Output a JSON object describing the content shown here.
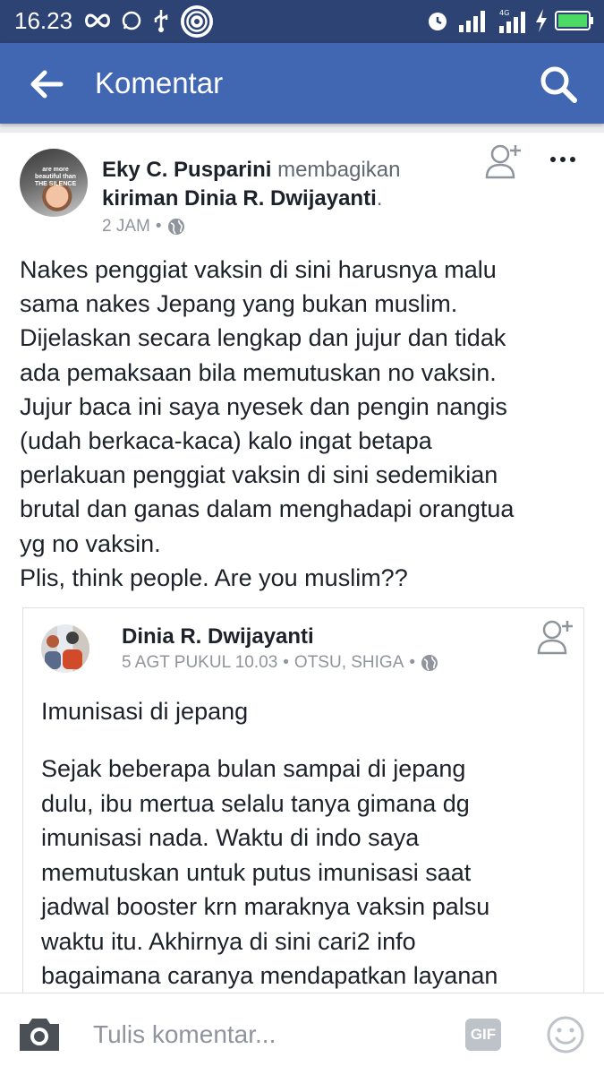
{
  "status_bar": {
    "time": "16.23",
    "icons": [
      "infinity-icon",
      "whatsapp-icon",
      "usb-icon",
      "hotspot-icon",
      "alarm-icon",
      "signal-icon",
      "4g-signal-icon",
      "charging-icon",
      "battery-icon"
    ]
  },
  "app_bar": {
    "title": "Komentar",
    "back_icon": "arrow-left-icon",
    "search_icon": "search-icon"
  },
  "post": {
    "author": "Eky C. Pusparini",
    "action": "membagikan",
    "shared_from": "kiriman Dinia R. Dwijayanti",
    "period": ".",
    "time": "2 JAM",
    "separator": "•",
    "privacy_icon": "globe-icon",
    "avatar_text": "are more beautiful than THE SILENCE",
    "lines": [
      "Nakes penggiat vaksin di sini harusnya malu",
      "sama nakes Jepang yang bukan muslim.",
      "Dijelaskan secara lengkap dan jujur dan tidak",
      "ada pemaksaan bila memutuskan no vaksin.",
      "Jujur baca ini saya nyesek dan pengin nangis",
      "(udah berkaca-kaca) kalo ingat betapa",
      "perlakuan penggiat vaksin di sini sedemikian",
      "brutal dan ganas dalam menghadapi orangtua",
      "yg no vaksin.",
      "Plis, think people. Are you muslim??"
    ]
  },
  "shared_post": {
    "author": "Dinia R. Dwijayanti",
    "date": "5 AGT PUKUL 10.03",
    "separator": "•",
    "location": "OTSU, SHIGA",
    "heading": "Imunisasi di jepang",
    "lines": [
      "Sejak beberapa bulan sampai di jepang",
      "dulu, ibu mertua selalu tanya gimana dg",
      "imunisasi nada. Waktu di indo saya",
      "memutuskan untuk putus imunisasi saat",
      "jadwal booster krn maraknya vaksin palsu",
      "waktu itu. Akhirnya di sini cari2 info",
      "bagaimana caranya mendapatkan layanan"
    ]
  },
  "composer": {
    "placeholder": "Tulis komentar...",
    "gif_label": "GIF"
  }
}
